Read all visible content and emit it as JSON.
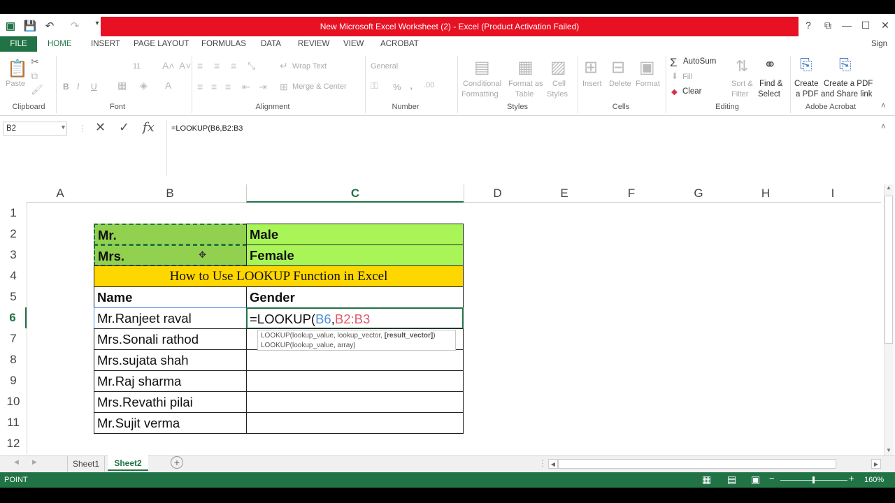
{
  "title": {
    "text": "New Microsoft Excel Worksheet (2)  -  Excel (Product Activation Failed)",
    "qat": [
      "excel-logo",
      "save-icon",
      "undo-icon",
      "redo-icon",
      "customize-icon"
    ],
    "help": "?",
    "signin": "Sign in"
  },
  "tabs": [
    "FILE",
    "HOME",
    "INSERT",
    "PAGE LAYOUT",
    "FORMULAS",
    "DATA",
    "REVIEW",
    "VIEW",
    "ACROBAT"
  ],
  "ribbon": {
    "clipboard": {
      "paste": "Paste",
      "group": "Clipboard"
    },
    "font": {
      "size": "11",
      "bold": "B",
      "italic": "I",
      "underline": "U",
      "group": "Font"
    },
    "alignment": {
      "wrap": "Wrap Text",
      "merge": "Merge & Center",
      "group": "Alignment"
    },
    "number": {
      "format": "General",
      "percent": "%",
      "comma": ",",
      "group": "Number"
    },
    "styles": {
      "cond1": "Conditional",
      "cond2": "Formatting",
      "fmt1": "Format as",
      "fmt2": "Table",
      "cs1": "Cell",
      "cs2": "Styles",
      "group": "Styles"
    },
    "cells": {
      "insert": "Insert",
      "delete": "Delete",
      "format": "Format",
      "group": "Cells"
    },
    "editing": {
      "autosum": "AutoSum",
      "fill": "Fill",
      "clear": "Clear",
      "sort1": "Sort &",
      "sort2": "Filter",
      "find1": "Find &",
      "find2": "Select",
      "group": "Editing"
    },
    "acrobat": {
      "create1": "Create",
      "create2": "a PDF",
      "share1": "Create a PDF",
      "share2": "and Share link",
      "group": "Adobe Acrobat"
    }
  },
  "formula_bar": {
    "name_box": "B2",
    "cancel": "✕",
    "enter": "✓",
    "fx": "fx",
    "formula": "=LOOKUP(B6,B2:B3"
  },
  "columns": [
    "A",
    "B",
    "C",
    "D",
    "E",
    "F",
    "G",
    "H",
    "I"
  ],
  "rows": [
    "1",
    "2",
    "3",
    "4",
    "5",
    "6",
    "7",
    "8",
    "9",
    "10",
    "11",
    "12"
  ],
  "cells": {
    "b2": "Mr.",
    "c2": "Male",
    "b3": "Mrs.",
    "c3": "Female",
    "title": "How to Use LOOKUP Function in Excel",
    "b5": "Name",
    "c5": "Gender",
    "b6": "Mr.Ranjeet raval",
    "c6_prefix": "=LOOKUP(",
    "c6_ref1": "B6",
    "c6_comma": ",",
    "c6_ref2": "B2:B3",
    "b7": "Mrs.Sonali rathod",
    "b8": "Mrs.sujata shah",
    "b9": "Mr.Raj sharma",
    "b10": "Mrs.Revathi pilai",
    "b11": "Mr.Sujit  verma"
  },
  "tooltip": {
    "line1_a": "LOOKUP(lookup_value, lookup_vector, ",
    "line1_b": "[result_vector]",
    "line1_c": ")",
    "line2": "LOOKUP(lookup_value, array)"
  },
  "sheets": [
    "Sheet1",
    "Sheet2"
  ],
  "status": {
    "mode": "POINT",
    "zoom": "160%"
  },
  "colors": {
    "excel_green": "#217346",
    "title_red": "#e81123",
    "header_fill": "#a9f558",
    "title_fill": "#ffd700",
    "ref_blue": "#4f8fd6",
    "ref_red": "#e05a6a"
  }
}
